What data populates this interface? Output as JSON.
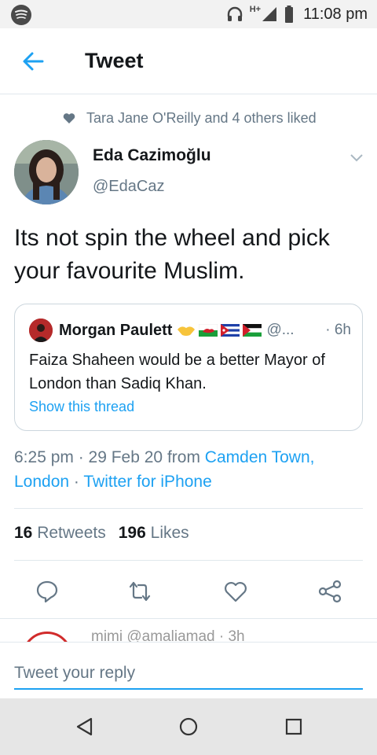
{
  "status_bar": {
    "network": "H+",
    "time": "11:08 pm"
  },
  "header": {
    "title": "Tweet"
  },
  "social_context": {
    "text": "Tara Jane O'Reilly and 4 others liked"
  },
  "tweet": {
    "author_name": "Eda Cazimoğlu",
    "author_handle": "@EdaCaz",
    "text": "Its not spin the wheel and pick your favourite Muslim.",
    "timestamp": "6:25 pm · 29 Feb 20 from ",
    "location_line1": "Camden Town,",
    "location_line2": "London",
    "separator": " · ",
    "source": "Twitter for iPhone",
    "retweets_count": "16",
    "retweets_label": "Retweets",
    "likes_count": "196",
    "likes_label": "Likes"
  },
  "quoted_tweet": {
    "author_name": "Morgan Paulett",
    "author_handle": "@...",
    "time": "· 6h",
    "text": "Faiza Shaheen would be a better Mayor of London than Sadiq Khan.",
    "show_thread": "Show this thread"
  },
  "next_tweet_peek": {
    "text": "mimi  @amaliamad · 3h"
  },
  "reply": {
    "placeholder": "Tweet your reply"
  },
  "colors": {
    "accent": "#1da1f2",
    "secondary_text": "#657786",
    "primary_text": "#14171a",
    "border": "#e1e8ed"
  },
  "icons": {
    "status": [
      "spotify-icon",
      "headphones-icon",
      "signal-icon",
      "battery-icon"
    ],
    "actions": [
      "reply-icon",
      "retweet-icon",
      "like-icon",
      "share-icon"
    ],
    "nav": [
      "nav-back-icon",
      "nav-home-icon",
      "nav-recents-icon"
    ]
  }
}
